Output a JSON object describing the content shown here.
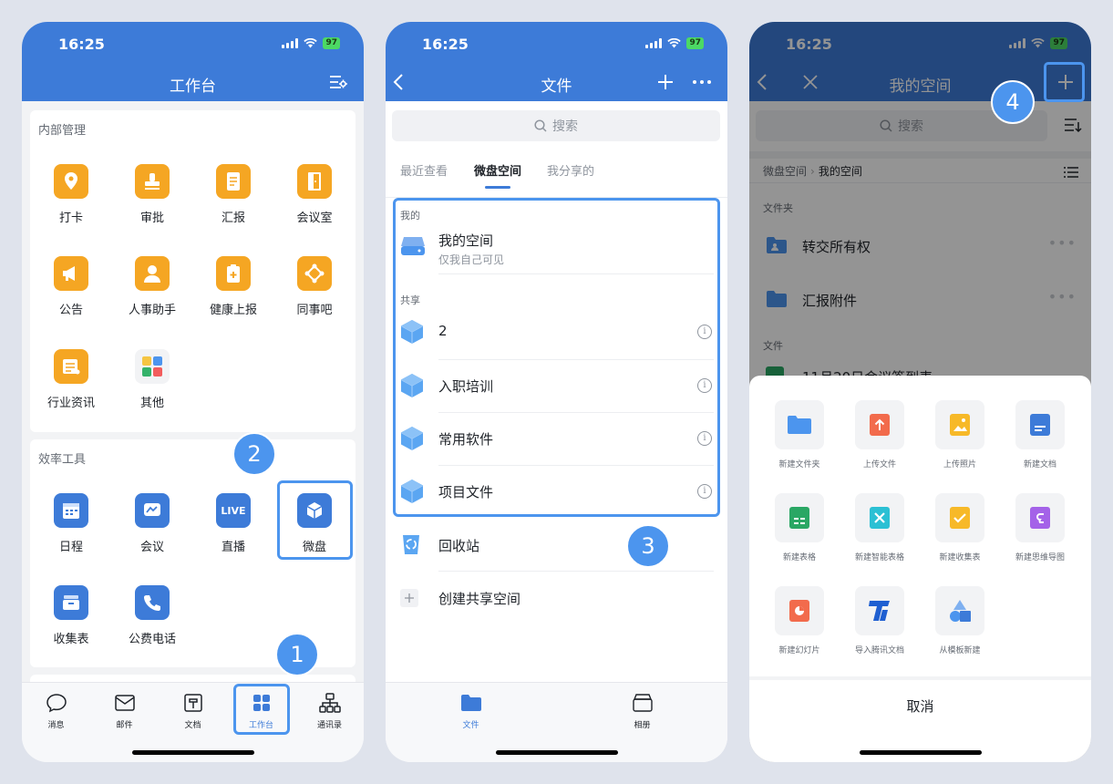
{
  "status": {
    "time": "16:25",
    "battery": "97"
  },
  "screen1": {
    "title": "工作台",
    "section_internal": "内部管理",
    "apps_internal": [
      "打卡",
      "审批",
      "汇报",
      "会议室",
      "公告",
      "人事助手",
      "健康上报",
      "同事吧",
      "行业资讯",
      "其他"
    ],
    "section_tools": "效率工具",
    "apps_tools": [
      "日程",
      "会议",
      "直播",
      "微盘",
      "收集表",
      "公费电话"
    ],
    "live_text": "LIVE",
    "tabs": [
      "消息",
      "邮件",
      "文档",
      "工作台",
      "通讯录"
    ]
  },
  "screen2": {
    "title": "文件",
    "search_placeholder": "搜索",
    "tabs": [
      "最近查看",
      "微盘空间",
      "我分享的"
    ],
    "mine_label": "我的",
    "my_space": "我的空间",
    "my_space_sub": "仅我自己可见",
    "shared_label": "共享",
    "shared_items": [
      "2",
      "入职培训",
      "常用软件",
      "项目文件"
    ],
    "recycle": "回收站",
    "create_shared": "创建共享空间",
    "bottom_tabs": [
      "文件",
      "相册"
    ]
  },
  "screen3": {
    "title": "我的空间",
    "search_placeholder": "搜索",
    "breadcrumb_root": "微盘空间",
    "breadcrumb_current": "我的空间",
    "folder_label": "文件夹",
    "folders": [
      "转交所有权",
      "汇报附件"
    ],
    "file_label": "文件",
    "file_peek": "11月20日会议签到表",
    "sheet_items": [
      "新建文件夹",
      "上传文件",
      "上传照片",
      "新建文档",
      "新建表格",
      "新建智能表格",
      "新建收集表",
      "新建思维导图",
      "新建幻灯片",
      "导入腾讯文档",
      "从模板新建"
    ],
    "cancel": "取消"
  },
  "badges": [
    "1",
    "2",
    "3",
    "4"
  ],
  "colors": {
    "brand": "#3d7bd8",
    "highlight": "#4c95ee",
    "app_yellow": "#f5a623"
  }
}
